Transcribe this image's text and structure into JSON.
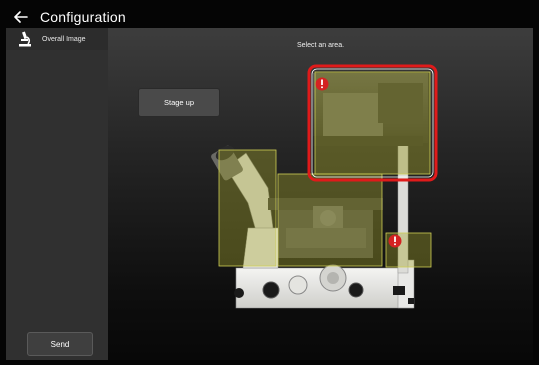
{
  "header": {
    "title": "Configuration",
    "back_icon": "back-arrow-icon"
  },
  "sidebar": {
    "items": [
      {
        "label": "Overall Image",
        "icon": "microscope-icon"
      }
    ],
    "send_label": "Send"
  },
  "main": {
    "prompt": "Select an area.",
    "stage_button_label": "Stage up"
  },
  "areas": [
    {
      "name": "eyepiece-tube-area",
      "warning": false,
      "selected": false
    },
    {
      "name": "stage-area",
      "warning": false,
      "selected": false
    },
    {
      "name": "illumination-pillar-area",
      "warning": true,
      "selected": true
    },
    {
      "name": "side-port-area",
      "warning": true,
      "selected": false
    }
  ],
  "colors": {
    "highlight_fill": "#9a9a2a",
    "selection_border": "#e01a1a",
    "warning": "#d42222",
    "sidebar": "#303030"
  }
}
